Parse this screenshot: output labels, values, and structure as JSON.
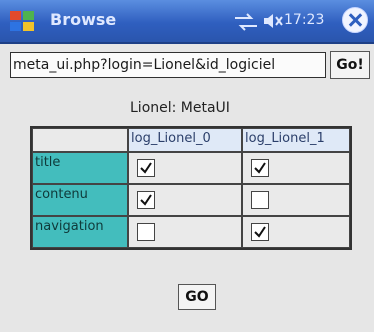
{
  "window": {
    "title": "Browse",
    "clock": "17:23"
  },
  "address_bar": {
    "url": "meta_ui.php?login=Lionel&id_logiciel",
    "go_label": "Go!"
  },
  "form": {
    "caption": "Lionel: MetaUI",
    "columns": [
      "log_Lionel_0",
      "log_Lionel_1"
    ],
    "rows": [
      {
        "label": "title",
        "checked": [
          true,
          true
        ]
      },
      {
        "label": "contenu",
        "checked": [
          true,
          false
        ]
      },
      {
        "label": "navigation",
        "checked": [
          false,
          true
        ]
      }
    ],
    "submit_label": "GO"
  },
  "colors": {
    "titlebar": "#2f5fbf",
    "row_header": "#43bdbd",
    "column_header": "#dfe9f7"
  }
}
